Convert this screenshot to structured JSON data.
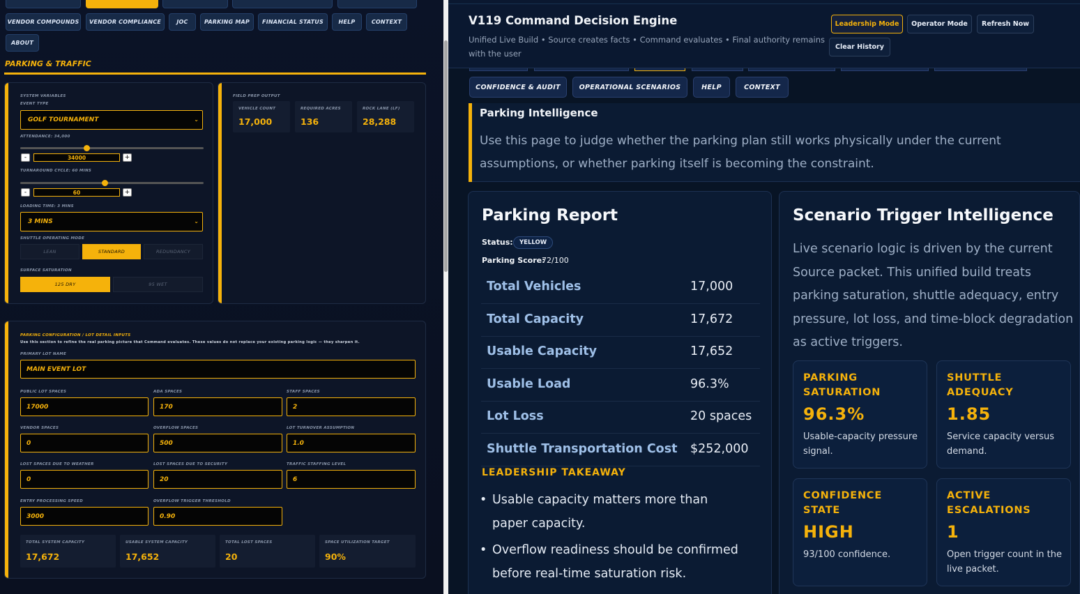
{
  "left": {
    "nav_tabs": [
      "Vendor Compounds",
      "Vendor Compliance",
      "JOC",
      "Parking Map",
      "Financial Status",
      "Help",
      "Context",
      "About"
    ],
    "section_title": "Parking & Traffic",
    "system": {
      "heading": "System Variables",
      "event_type_label": "Event Type",
      "event_type_value": "Golf Tournament",
      "attendance_label": "Attendance: 34,000",
      "attendance_value": "34000",
      "attendance_level": 0.36,
      "turnaround_label": "Turnaround Cycle: 60 Mins",
      "turnaround_value": "60",
      "turnaround_level": 0.46,
      "loading_label": "Loading Time: 3 Mins",
      "loading_value": "3 Mins",
      "shuttle_mode_label": "Shuttle Operating Mode",
      "shuttle_modes": [
        "Lean",
        "Standard",
        "Redundancy"
      ],
      "shuttle_mode_selected": "Standard",
      "surface_label": "Surface Saturation",
      "surface_options": [
        "125 Dry",
        "95 Wet"
      ],
      "surface_selected": "125 Dry",
      "minus": "-",
      "plus": "+"
    },
    "field_prep": {
      "heading": "Field Prep Output",
      "stats": [
        {
          "label": "Vehicle Count",
          "value": "17,000"
        },
        {
          "label": "Required Acres",
          "value": "136"
        },
        {
          "label": "Rock Lane (LF)",
          "value": "28,288"
        }
      ]
    },
    "lot_config": {
      "heading": "Parking Configuration / Lot Detail Inputs",
      "description": "Use this section to refine the real parking picture that Command evaluates. These values do not replace your existing parking logic — they sharpen it.",
      "primary_lot_label": "Primary Lot Name",
      "primary_lot_value": "Main Event Lot",
      "fields": [
        {
          "label": "Public Lot Spaces",
          "value": "17000"
        },
        {
          "label": "ADA Spaces",
          "value": "170"
        },
        {
          "label": "Staff Spaces",
          "value": "2"
        },
        {
          "label": "Vendor Spaces",
          "value": "0"
        },
        {
          "label": "Overflow Spaces",
          "value": "500"
        },
        {
          "label": "Lot Turnover Assumption",
          "value": "1.0"
        },
        {
          "label": "Lost Spaces Due To Weather",
          "value": "0"
        },
        {
          "label": "Lost Spaces Due To Security",
          "value": "20"
        },
        {
          "label": "Traffic Staffing Level",
          "value": "6"
        },
        {
          "label": "Entry Processing Speed",
          "value": "3000"
        },
        {
          "label": "Overflow Trigger Threshold",
          "value": "0.90"
        }
      ],
      "totals": [
        {
          "label": "Total System Capacity",
          "value": "17,672"
        },
        {
          "label": "Usable System Capacity",
          "value": "17,652"
        },
        {
          "label": "Total Lost Spaces",
          "value": "20"
        },
        {
          "label": "Space Utilization Target",
          "value": "90%"
        }
      ]
    }
  },
  "right": {
    "header": {
      "title": "V119 Command Decision Engine",
      "subtitle": "Unified Live Build • Source creates facts • Command evaluates • Final authority remains with the user",
      "buttons": [
        "Leadership Mode",
        "Operator Mode",
        "Refresh Now",
        "Clear History"
      ]
    },
    "tabs": [
      "Confidence & Audit",
      "Operational Scenarios",
      "Help",
      "Context"
    ],
    "intel": {
      "title": "Parking Intelligence",
      "text": "Use this page to judge whether the parking plan still works physically under the current assumptions, or whether parking itself is becoming the constraint."
    },
    "report": {
      "title": "Parking Report",
      "status_label": "Status:",
      "status_value": "YELLOW",
      "score_label": "Parking Score:",
      "score_value": "72/100",
      "rows": [
        {
          "k": "Total Vehicles",
          "v": "17,000"
        },
        {
          "k": "Total Capacity",
          "v": "17,672"
        },
        {
          "k": "Usable Capacity",
          "v": "17,652"
        },
        {
          "k": "Usable Load",
          "v": "96.3%"
        },
        {
          "k": "Lot Loss",
          "v": "20 spaces"
        },
        {
          "k": "Shuttle Transportation Cost",
          "v": "$252,000"
        }
      ],
      "takeaway_title": "Leadership Takeaway",
      "takeaways": [
        "Usable capacity matters more than paper capacity.",
        "Overflow readiness should be confirmed before real-time saturation risk."
      ]
    },
    "scenario": {
      "title": "Scenario Trigger Intelligence",
      "text": "Live scenario logic is driven by the current Source packet. This unified build treats parking saturation, shuttle adequacy, entry pressure, lot loss, and time-block degradation as active triggers.",
      "metrics": [
        {
          "title": "Parking Saturation",
          "value": "96.3%",
          "desc": "Usable-capacity pressure signal."
        },
        {
          "title": "Shuttle Adequacy",
          "value": "1.85",
          "desc": "Service capacity versus demand."
        },
        {
          "title": "Confidence State",
          "value": "HIGH",
          "desc": "93/100 confidence."
        },
        {
          "title": "Active Escalations",
          "value": "1",
          "desc": "Open trigger count in the live packet."
        }
      ]
    }
  },
  "colors": {
    "accent": "#f5b20b",
    "panel": "#0d1527",
    "right_bg": "#081425"
  }
}
